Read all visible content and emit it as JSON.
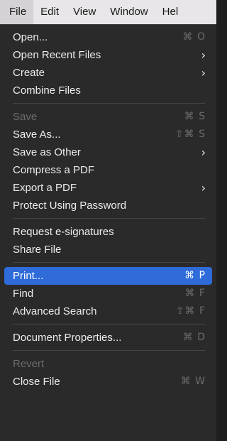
{
  "menubar": {
    "items": [
      {
        "label": "File"
      },
      {
        "label": "Edit"
      },
      {
        "label": "View"
      },
      {
        "label": "Window"
      },
      {
        "label": "Hel"
      }
    ]
  },
  "file_menu": {
    "open": {
      "label": "Open...",
      "shortcut": "⌘ O"
    },
    "open_recent": {
      "label": "Open Recent Files",
      "submenu_icon": "chevron-right-icon"
    },
    "create": {
      "label": "Create",
      "submenu_icon": "chevron-right-icon"
    },
    "combine": {
      "label": "Combine Files"
    },
    "save": {
      "label": "Save",
      "shortcut": "⌘ S"
    },
    "save_as": {
      "label": "Save As...",
      "shortcut": "⇧⌘ S"
    },
    "save_as_other": {
      "label": "Save as Other",
      "submenu_icon": "chevron-right-icon"
    },
    "compress": {
      "label": "Compress a PDF"
    },
    "export": {
      "label": "Export a PDF",
      "submenu_icon": "chevron-right-icon"
    },
    "protect": {
      "label": "Protect Using Password"
    },
    "request_signatures": {
      "label": "Request e-signatures"
    },
    "share": {
      "label": "Share File"
    },
    "print": {
      "label": "Print...",
      "shortcut": "⌘ P"
    },
    "find": {
      "label": "Find",
      "shortcut": "⌘ F"
    },
    "advanced_search": {
      "label": "Advanced Search",
      "shortcut": "⇧⌘ F"
    },
    "document_properties": {
      "label": "Document Properties...",
      "shortcut": "⌘ D"
    },
    "revert": {
      "label": "Revert"
    },
    "close": {
      "label": "Close File",
      "shortcut": "⌘ W"
    }
  },
  "colors": {
    "menu_background": "#2b2a2b",
    "highlight": "#2f6bd9",
    "menubar_background": "#e8e6e8"
  }
}
